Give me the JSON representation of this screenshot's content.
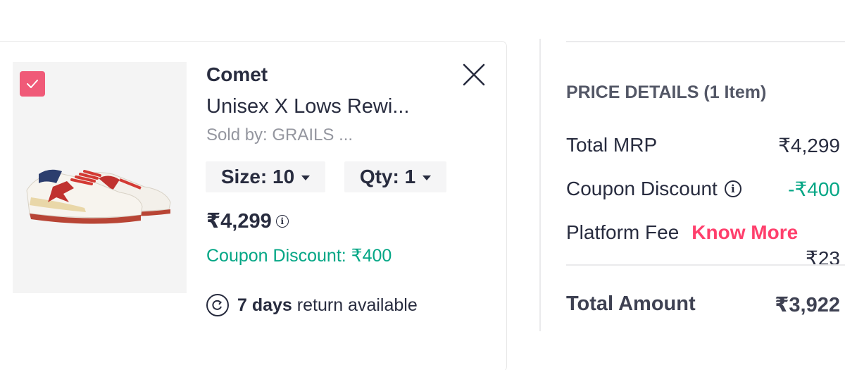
{
  "colors": {
    "accent": "#ff3f6c",
    "checkbox": "#f05a78",
    "discount_green": "#03a685",
    "text_primary": "#282c3f",
    "text_muted": "#94969f"
  },
  "cart_item": {
    "selected": true,
    "brand": "Comet",
    "name": "Unisex X Lows Rewi...",
    "seller": "Sold by: GRAILS ...",
    "size_label": "Size: 10",
    "qty_label": "Qty: 1",
    "price": "₹4,299",
    "price_info_icon": "i",
    "coupon_discount": "Coupon Discount: ₹400",
    "return_days": "7 days",
    "return_text": "return available",
    "icons": [
      "check-icon",
      "close-icon",
      "info-icon",
      "return-icon",
      "chevron-down-icon"
    ]
  },
  "price_details": {
    "title": "PRICE DETAILS (1 Item)",
    "total_mrp_label": "Total MRP",
    "total_mrp_value": "₹4,299",
    "coupon_label": "Coupon Discount",
    "coupon_info_icon": "i",
    "coupon_value": "-₹400",
    "platform_fee_label": "Platform Fee",
    "know_more": "Know More",
    "platform_fee_value": "₹23",
    "total_label": "Total Amount",
    "total_value": "₹3,922"
  }
}
